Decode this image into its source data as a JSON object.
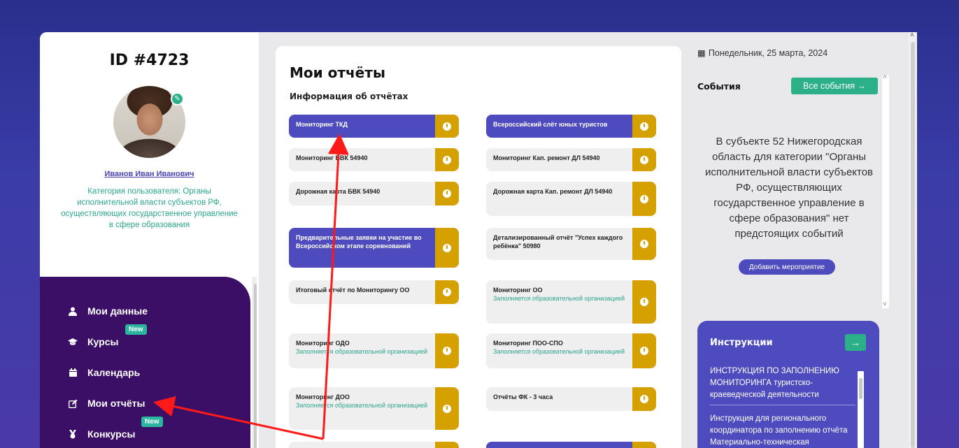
{
  "sidebar": {
    "user_id": "ID #4723",
    "user_name": "Иванов Иван Иванович",
    "user_category": "Категория пользователя: Органы исполнительной власти субъектов РФ, осуществляющих государственное управление в сфере образования",
    "nav": [
      {
        "label": "Мои данные",
        "icon": "user-icon"
      },
      {
        "label": "Курсы",
        "icon": "graduation-cap-icon",
        "badge": "New"
      },
      {
        "label": "Календарь",
        "icon": "calendar-icon"
      },
      {
        "label": "Мои отчёты",
        "icon": "edit-icon"
      },
      {
        "label": "Конкурсы",
        "icon": "medal-icon",
        "badge": "New"
      }
    ]
  },
  "main": {
    "title": "Мои отчёты",
    "subtitle": "Информация об отчётах",
    "reports": [
      {
        "title": "Мониторинг ТКД",
        "sub": "",
        "style": "blue"
      },
      {
        "title": "Всероссийский слёт юных туристов",
        "sub": "",
        "style": "blue"
      },
      {
        "title": "Мониторинг БВК 54940",
        "sub": "",
        "style": "gray"
      },
      {
        "title": "Мониторинг Кап. ремонт ДЛ 54940",
        "sub": "",
        "style": "gray"
      },
      {
        "title": "Дорожная карта БВК 54940",
        "sub": "",
        "style": "gray"
      },
      {
        "title": "Дорожная карта Кап. ремонт ДЛ 54940",
        "sub": "",
        "style": "gray"
      },
      {
        "title": "Предварительные заявки на участие во Всероссийском этапе соревнований",
        "sub": "",
        "style": "blue"
      },
      {
        "title": "Детализированный отчёт \"Успех каждого ребёнка\" 50980",
        "sub": "",
        "style": "gray"
      },
      {
        "title": "Итоговый отчёт по Мониторингу ОО",
        "sub": "",
        "style": "gray"
      },
      {
        "title": "Мониторинг ОО",
        "sub": "Заполняется образовательной организацией",
        "style": "gray"
      },
      {
        "title": "Мониторинг ОДО",
        "sub": "Заполняется образовательной организацией",
        "style": "gray"
      },
      {
        "title": "Мониторинг ПОО-СПО",
        "sub": "Заполняется образовательной организацией",
        "style": "gray"
      },
      {
        "title": "Мониторинг ДОО",
        "sub": "Заполняется образовательной организацией",
        "style": "gray"
      },
      {
        "title": "Отчёты ФК - 3 часа",
        "sub": "",
        "style": "gray"
      }
    ]
  },
  "right": {
    "date": "Понедельник, 25 марта, 2024",
    "events_title": "События",
    "events_button": "Все события →",
    "events_text": "В субъекте 52 Нижегородская область для категории \"Органы исполнительной власти субъектов РФ, осуществляющих государственное управление в сфере образования\" нет предстоящих событий",
    "add_event": "Добавить мероприятие",
    "instructions_title": "Инструкции",
    "instructions_button": "→",
    "instructions": [
      "ИНСТРУКЦИЯ ПО ЗАПОЛНЕНИЮ МОНИТОРИНГА туристско-краеведческой деятельности",
      "Инструкция для регионального координатора по заполнению отчёта Материально-техническая"
    ]
  },
  "colors": {
    "accent": "#4d4bbd",
    "clock": "#d4a100",
    "green": "#2bb088",
    "nav_bg": "#3b0f66",
    "annotation_arrow": "#ff1a1a"
  }
}
